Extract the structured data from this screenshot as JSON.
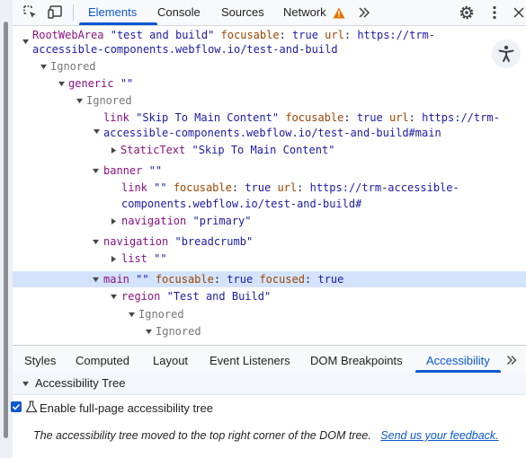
{
  "toolbar": {
    "tabs": [
      "Elements",
      "Console",
      "Sources",
      "Network"
    ],
    "active_tab": "Elements",
    "more_tabs_icon": "chevron-double-right-icon",
    "network_warning_icon": "warning-icon",
    "settings_icon": "gear-icon",
    "menu_icon": "kebab-menu-icon"
  },
  "tree": {
    "l0": {
      "role": "RootWebArea",
      "name": "\"test and build\"",
      "a1": "focusable",
      "v1": "true",
      "a2": "url",
      "v2": "https://trm-",
      "cont": "accessible-components.webflow.io/test-and-build"
    },
    "l1": {
      "text": "Ignored"
    },
    "l2": {
      "role": "generic",
      "name": "\"\""
    },
    "l3": {
      "text": "Ignored"
    },
    "l4": {
      "role": "link",
      "name": "\"Skip To Main Content\"",
      "a1": "focusable",
      "v1": "true",
      "a2": "url",
      "v2": "https://trm-",
      "cont": "accessible-components.webflow.io/test-and-build#main"
    },
    "l5": {
      "role": "StaticText",
      "name": "\"Skip To Main Content\""
    },
    "l6": {
      "role": "banner",
      "name": "\"\""
    },
    "l7": {
      "role": "link",
      "name": "\"\"",
      "a1": "focusable",
      "v1": "true",
      "a2": "url",
      "v2": "https://trm-accessible-",
      "cont": "components.webflow.io/test-and-build#"
    },
    "l8": {
      "role": "navigation",
      "name": "\"primary\""
    },
    "l9": {
      "role": "navigation",
      "name": "\"breadcrumb\""
    },
    "l10": {
      "role": "list",
      "name": "\"\""
    },
    "l11": {
      "role": "main",
      "name": "\"\"",
      "a1": "focusable",
      "v1": "true",
      "a2": "focused",
      "v2": "true"
    },
    "l12": {
      "role": "region",
      "name": "\"Test and Build\""
    },
    "l13": {
      "text": "Ignored"
    },
    "l14": {
      "text": "Ignored"
    }
  },
  "accessibility_button_icon": "accessibility-person-icon",
  "bottom_tabs": [
    "Styles",
    "Computed",
    "Layout",
    "Event Listeners",
    "DOM Breakpoints",
    "Accessibility"
  ],
  "bottom_active_tab": "Accessibility",
  "bottom_more_icon": "chevron-double-right-icon",
  "section": {
    "title": "Accessibility Tree"
  },
  "enable_checkbox": {
    "label": "Enable full-page accessibility tree",
    "checked": true
  },
  "notice": {
    "text": "The accessibility tree moved to the top right corner of the DOM tree.",
    "link": "Send us your feedback."
  },
  "colors": {
    "accent": "#0b57d0",
    "selection": "#d4e3fc",
    "role": "#881280",
    "attribute": "#994500",
    "value": "#1a1aa6"
  }
}
